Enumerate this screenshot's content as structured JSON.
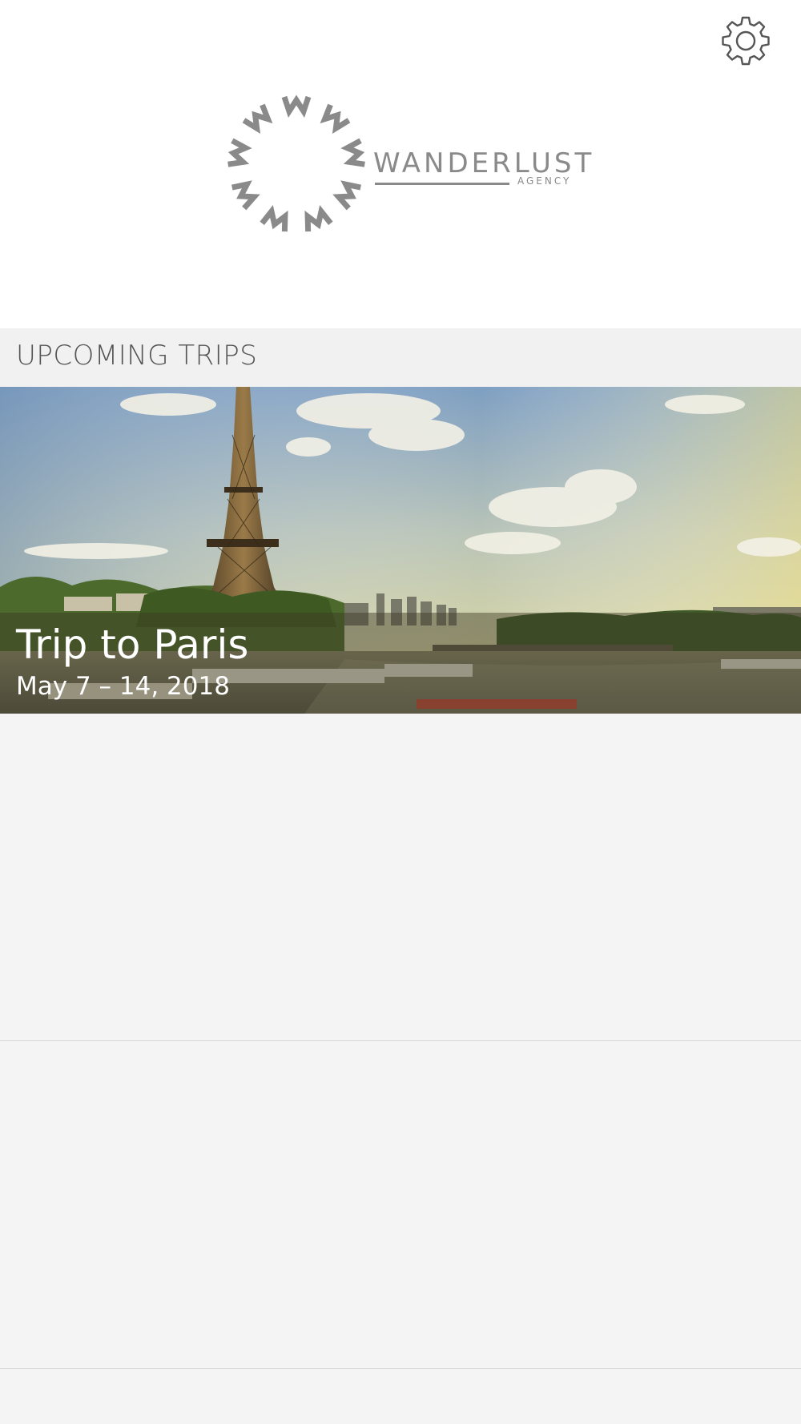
{
  "header": {
    "settings_icon": "gear-icon",
    "logo": {
      "wordmark": "WANDERLUST",
      "subtitle": "AGENCY",
      "color": "#8a8a8a"
    }
  },
  "upcoming": {
    "section_title": "UPCOMING TRIPS",
    "trips": [
      {
        "title": "Trip to Paris",
        "dates": "May 7 – 14, 2018"
      }
    ]
  }
}
